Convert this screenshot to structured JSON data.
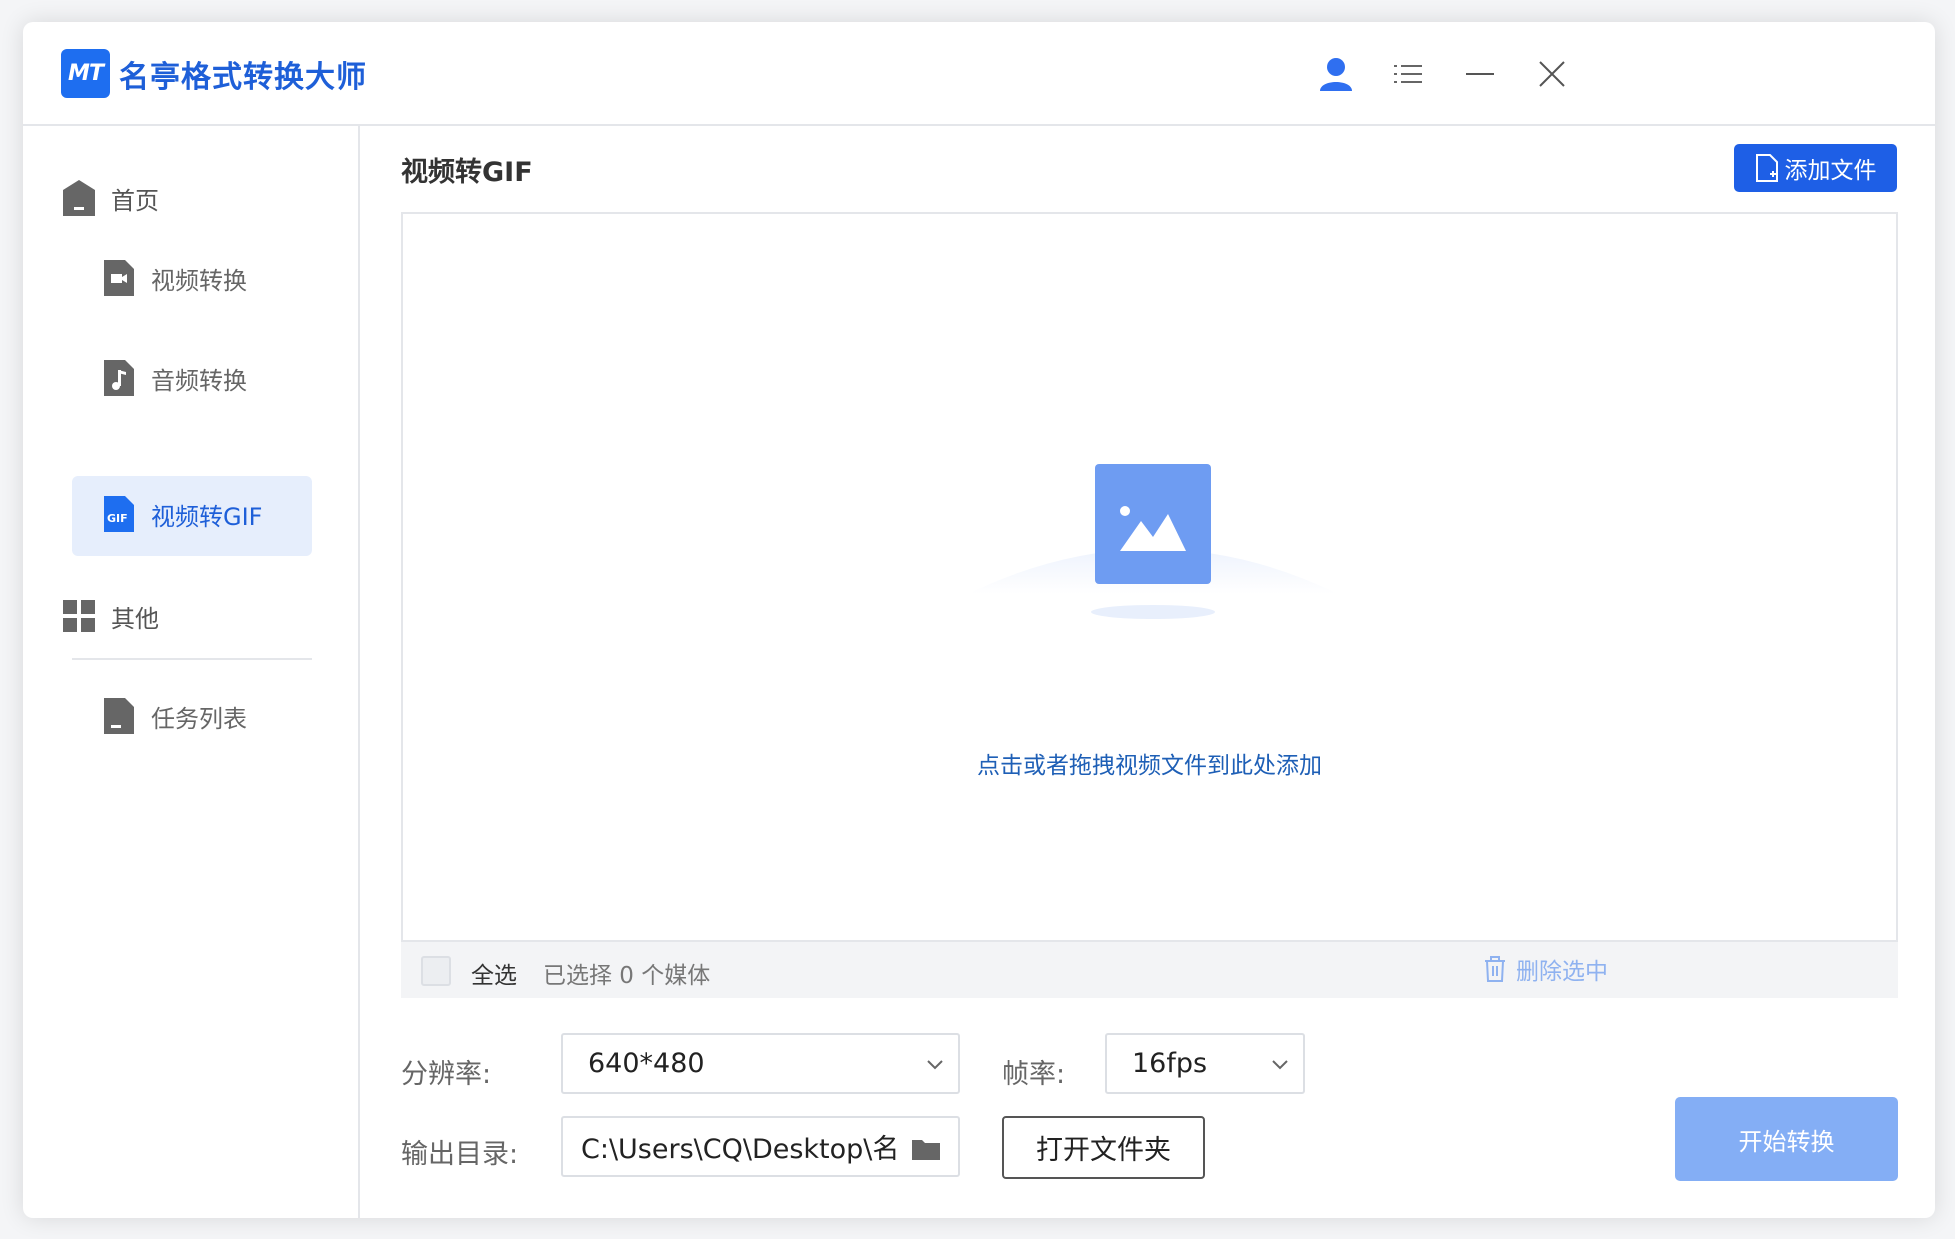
{
  "app": {
    "logo_text": "MT",
    "title": "名亭格式转换大师"
  },
  "window_controls": [
    "user-icon",
    "menu-icon",
    "minimize-icon",
    "close-icon"
  ],
  "sidebar": {
    "items": [
      {
        "label": "首页",
        "icon": "home-icon"
      },
      {
        "label": "视频转换",
        "icon": "video-file-icon"
      },
      {
        "label": "音频转换",
        "icon": "audio-file-icon"
      },
      {
        "label": "视频转GIF",
        "icon": "gif-file-icon",
        "active": true
      },
      {
        "label": "其他",
        "icon": "grid-icon"
      },
      {
        "label": "任务列表",
        "icon": "task-file-icon"
      }
    ]
  },
  "main": {
    "title": "视频转GIF",
    "add_button": "添加文件",
    "drop_hint": "点击或者拖拽视频文件到此处添加",
    "select_all": "全选",
    "selected_count": "已选择 0 个媒体",
    "delete_selected": "删除选中"
  },
  "settings": {
    "resolution_label": "分辨率:",
    "resolution_value": "640*480",
    "framerate_label": "帧率:",
    "framerate_value": "16fps",
    "output_label": "输出目录:",
    "output_value": "C:\\Users\\CQ\\Desktop\\名",
    "open_folder": "打开文件夹",
    "start": "开始转换"
  },
  "colors": {
    "accent": "#1e5fe6",
    "active_bg": "#e6eefc",
    "start_disabled": "#84aef5"
  }
}
